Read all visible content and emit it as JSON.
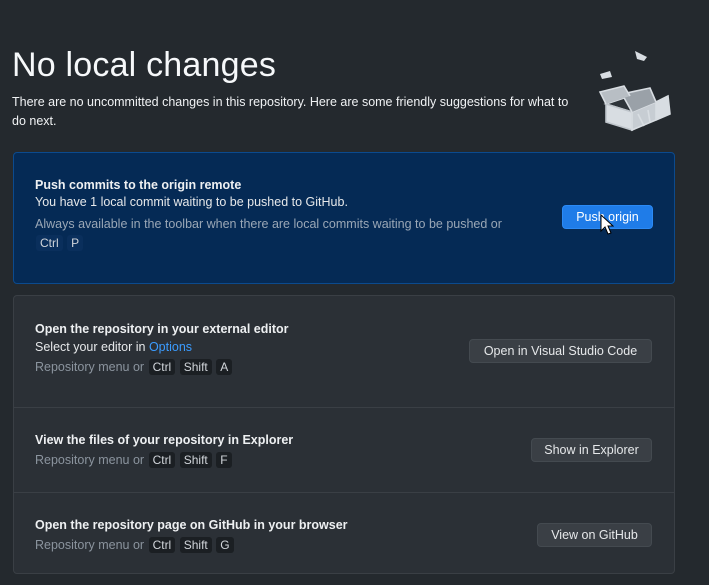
{
  "header": {
    "title": "No local changes",
    "description": "There are no uncommitted changes in this repository. Here are some friendly suggestions for what to do next."
  },
  "push": {
    "title": "Push commits to the origin remote",
    "subtitle": "You have 1 local commit waiting to be pushed to GitHub.",
    "hint": "Always available in the toolbar when there are local commits waiting to be pushed or",
    "shortcut": [
      "Ctrl",
      "P"
    ],
    "button_label": "Push origin"
  },
  "editor": {
    "title": "Open the repository in your external editor",
    "subtitle_prefix": "Select your editor in ",
    "subtitle_link": "Options",
    "hint": "Repository menu or",
    "shortcut": [
      "Ctrl",
      "Shift",
      "A"
    ],
    "button_label": "Open in Visual Studio Code"
  },
  "explorer": {
    "title": "View the files of your repository in Explorer",
    "hint": "Repository menu or",
    "shortcut": [
      "Ctrl",
      "Shift",
      "F"
    ],
    "button_label": "Show in Explorer"
  },
  "github": {
    "title": "Open the repository page on GitHub in your browser",
    "hint": "Repository menu or",
    "shortcut": [
      "Ctrl",
      "Shift",
      "G"
    ],
    "button_label": "View on GitHub"
  },
  "colors": {
    "background": "#24292e",
    "primary_card": "#052a55",
    "accent_button": "#1f7ce8",
    "link": "#3b9cff"
  },
  "icons": [
    "empty-box-illustration-icon",
    "mouse-cursor-icon"
  ]
}
